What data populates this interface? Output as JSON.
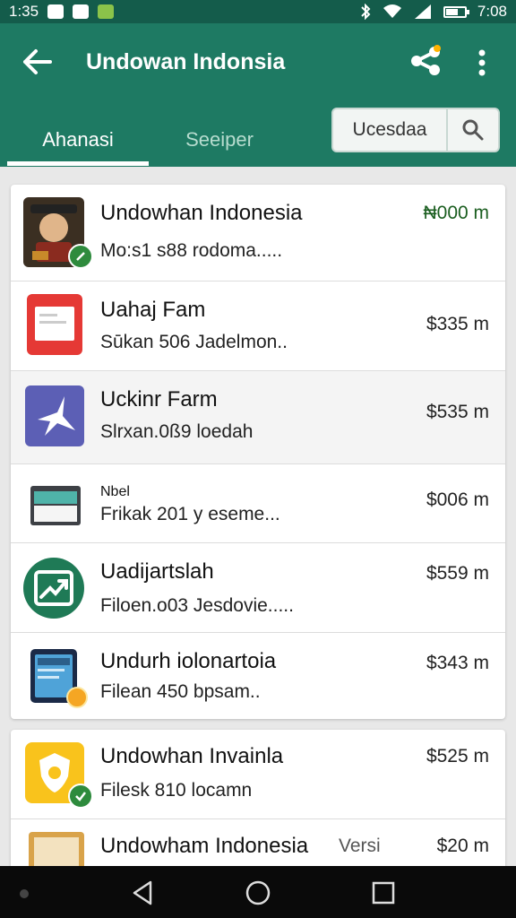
{
  "status_bar": {
    "time_left": "1:35",
    "time_right": "7:08",
    "icons": [
      "notification-icon",
      "mail-icon",
      "app-icon",
      "bluetooth-icon",
      "wifi-icon",
      "signal-icon",
      "battery-icon"
    ]
  },
  "app_bar": {
    "title": "Undowan Indonsia",
    "back_icon": "arrow-left-icon",
    "share_icon": "share-icon",
    "more_icon": "more-vert-icon",
    "color": "#1e7a63",
    "status_color": "#145c4b"
  },
  "tabs": [
    {
      "label": "Ahanasi",
      "active": true
    },
    {
      "label": "Seeiper",
      "active": false
    }
  ],
  "search": {
    "value": "Ucesdaa",
    "icon": "search-icon"
  },
  "list": [
    {
      "name": "Undowhan Indonesia",
      "subtitle": "Mo:s1 s88 rodoma.....",
      "price": "₦000 m",
      "icon": "character-app-icon",
      "price_color": "#1b5e20"
    },
    {
      "name": "Uahaj Fam",
      "subtitle": "Sūkan 506 Jadelmon..",
      "price": "$335 m",
      "icon": "red-form-app-icon"
    },
    {
      "name": "Uckinr Farm",
      "subtitle": "Slrxan.0ß9 loedah",
      "price": "$535 m",
      "icon": "star-app-icon"
    },
    {
      "name": "Frikak 201 y eseme...",
      "label": "Nbel",
      "price": "$006 m",
      "icon": "folder-app-icon"
    },
    {
      "name": "Uadijartslah",
      "subtitle": "Filoen.o03 Jesdovie.....",
      "price": "$559 m",
      "icon": "trend-app-icon"
    },
    {
      "name": "Undurh iolonartoia",
      "subtitle": "Filean 450 bpsam..",
      "price": "$343 m",
      "icon": "tablet-app-icon"
    }
  ],
  "list2": [
    {
      "name": "Undowhan Invainla",
      "subtitle": "Filesk 810 locamn",
      "price": "$525 m",
      "icon": "shield-app-icon"
    },
    {
      "name": "Undowham Indonesia",
      "tag": "Versi",
      "price": "$20 m",
      "icon": "box-app-icon"
    }
  ],
  "nav": {
    "back": "nav-back-icon",
    "home": "nav-home-icon",
    "recents": "nav-recents-icon"
  }
}
